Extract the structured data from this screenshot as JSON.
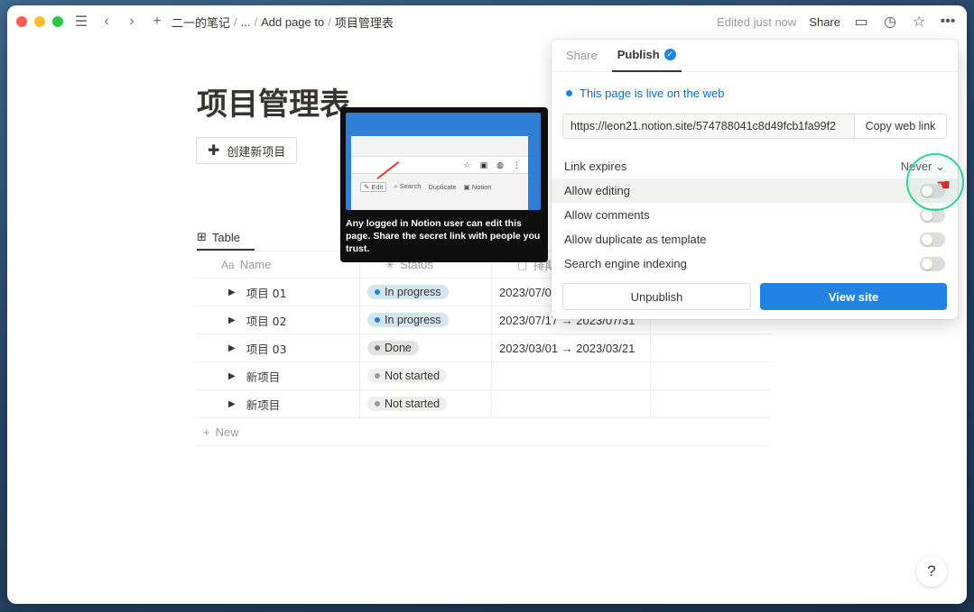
{
  "topbar": {
    "breadcrumbs": [
      "二一的笔记",
      "...",
      "Add page to",
      "项目管理表"
    ],
    "edited": "Edited just now",
    "share": "Share"
  },
  "page": {
    "title": "项目管理表",
    "new_project_button": "创建新项目",
    "view_tab": "Table",
    "table": {
      "headers": {
        "name": "Name",
        "status": "Status",
        "date": "排期"
      },
      "rows": [
        {
          "name": "项目 01",
          "status": "In progress",
          "date": "2023/07/0"
        },
        {
          "name": "项目 02",
          "status": "In progress",
          "date": "2023/07/17 → 2023/07/31"
        },
        {
          "name": "项目 03",
          "status": "Done",
          "date": "2023/03/01 → 2023/03/21"
        },
        {
          "name": "新项目",
          "status": "Not started",
          "date": ""
        },
        {
          "name": "新项目",
          "status": "Not started",
          "date": ""
        }
      ],
      "new_label": "New"
    }
  },
  "status_colors": {
    "In progress": {
      "bg": "#d3e5ef",
      "dot": "#2383e2"
    },
    "Done": {
      "bg": "#e3e2e0",
      "dot": "#787774"
    },
    "Not started": {
      "bg": "#efefed",
      "dot": "#9b9a97"
    }
  },
  "tooltip": {
    "preview_edit": "Edit",
    "preview_search": "Search",
    "preview_duplicate": "Duplicate",
    "preview_notion": "Notion",
    "text": "Any logged in Notion user can edit this page. Share the secret link with people you trust."
  },
  "panel": {
    "tab_share": "Share",
    "tab_publish": "Publish",
    "live_text": "This page is live on the web",
    "url": "https://leon21.notion.site/574788041c8d49fcb1fa99f2",
    "copy_link": "Copy web link",
    "link_expires": "Link expires",
    "never": "Never",
    "allow_editing": "Allow editing",
    "allow_comments": "Allow comments",
    "allow_duplicate": "Allow duplicate as template",
    "search_indexing": "Search engine indexing",
    "unpublish": "Unpublish",
    "view_site": "View site",
    "accent": "#2383e2"
  },
  "help": "?"
}
